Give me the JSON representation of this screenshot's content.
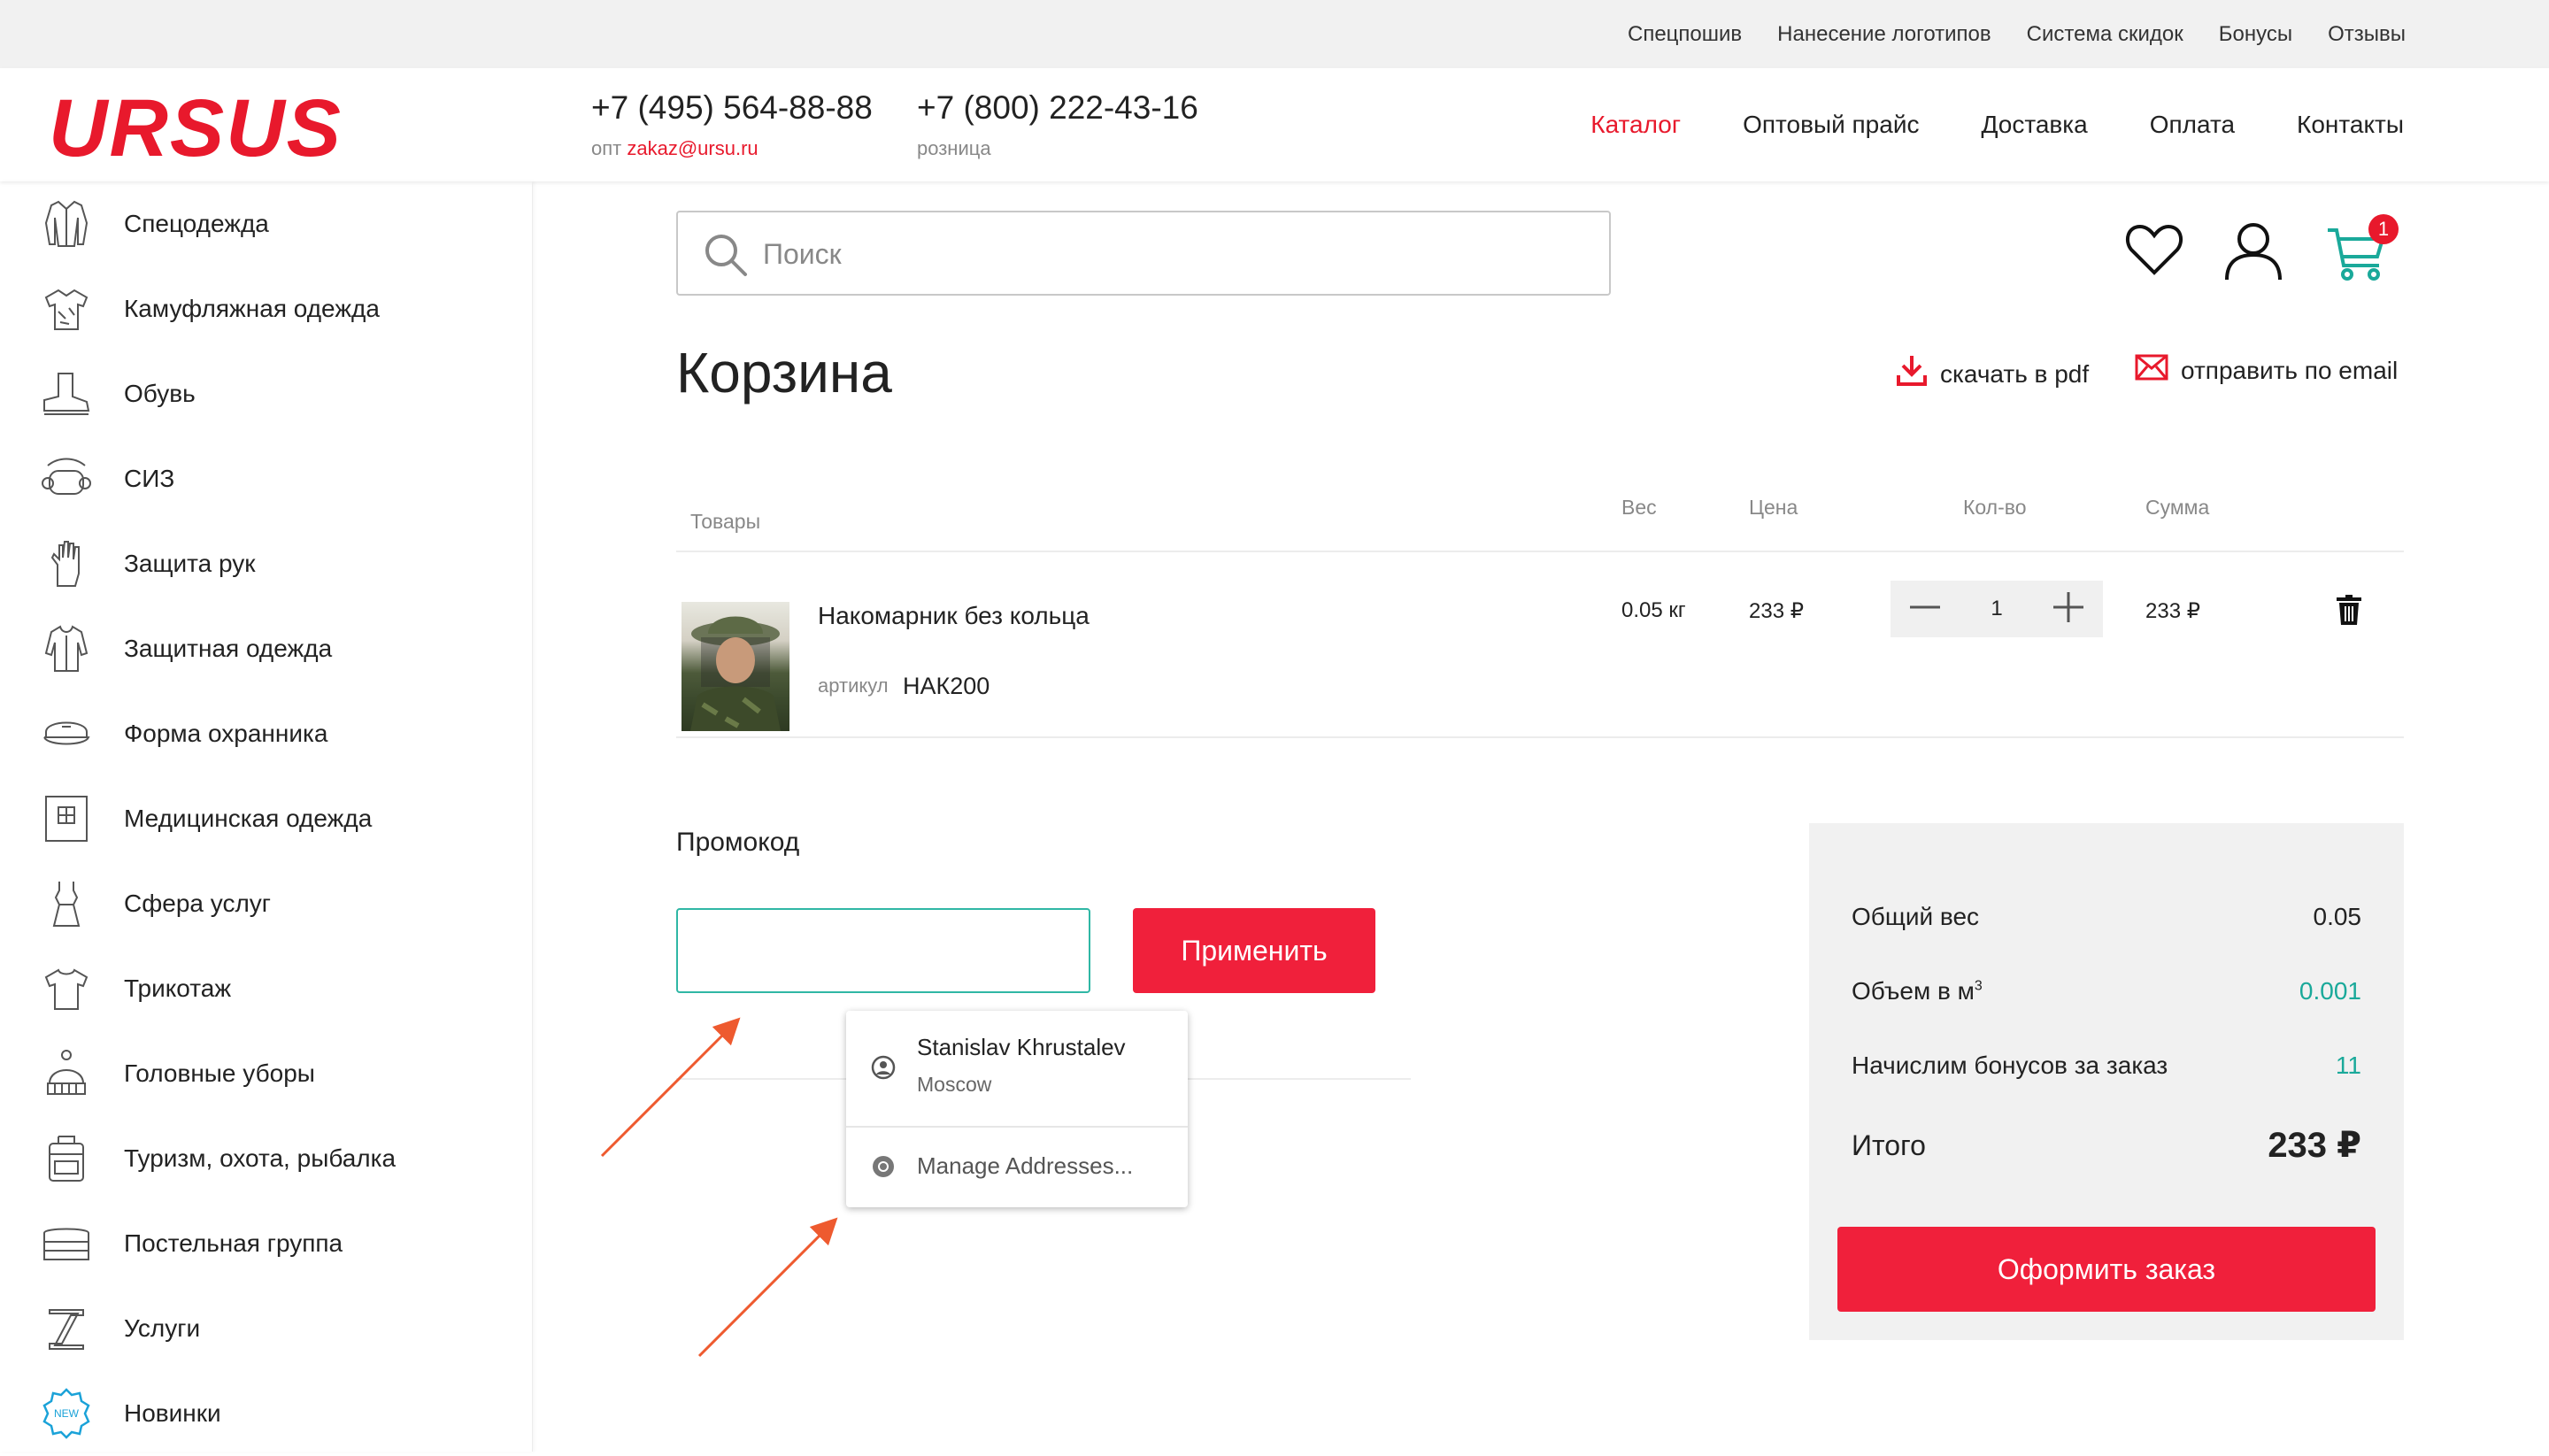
{
  "topbar": {
    "links": [
      "Спецпошив",
      "Нанесение логотипов",
      "Система скидок",
      "Бонусы",
      "Отзывы"
    ]
  },
  "header": {
    "logo": "URSUS",
    "phone_wholesale": "+7 (495) 564-88-88",
    "phone_wholesale_prefix": "опт",
    "phone_wholesale_email": "zakaz@ursu.ru",
    "phone_retail": "+7 (800) 222-43-16",
    "phone_retail_sub": "розница",
    "nav": [
      "Каталог",
      "Оптовый прайс",
      "Доставка",
      "Оплата",
      "Контакты"
    ],
    "nav_active": "Каталог"
  },
  "sidebar": {
    "items": [
      {
        "label": "Спецодежда",
        "icon": "jacket-icon"
      },
      {
        "label": "Камуфляжная одежда",
        "icon": "camo-shirt-icon"
      },
      {
        "label": "Обувь",
        "icon": "boot-icon"
      },
      {
        "label": "СИЗ",
        "icon": "respirator-icon"
      },
      {
        "label": "Защита рук",
        "icon": "glove-icon"
      },
      {
        "label": "Защитная одежда",
        "icon": "protective-suit-icon"
      },
      {
        "label": "Форма охранника",
        "icon": "guard-cap-icon"
      },
      {
        "label": "Медицинская одежда",
        "icon": "medical-icon"
      },
      {
        "label": "Сфера услуг",
        "icon": "dress-icon"
      },
      {
        "label": "Трикотаж",
        "icon": "tshirt-icon"
      },
      {
        "label": "Головные уборы",
        "icon": "hat-icon"
      },
      {
        "label": "Туризм, охота, рыбалка",
        "icon": "backpack-icon"
      },
      {
        "label": "Постельная группа",
        "icon": "bedding-icon"
      },
      {
        "label": "Услуги",
        "icon": "services-icon"
      },
      {
        "label": "Новинки",
        "icon": "new-badge-icon"
      }
    ]
  },
  "search": {
    "placeholder": "Поиск"
  },
  "cart_badge": "1",
  "page": {
    "title": "Корзина",
    "download_pdf": "скачать в pdf",
    "send_email": "отправить по email"
  },
  "table": {
    "headers": {
      "goods": "Товары",
      "weight": "Вес",
      "price": "Цена",
      "qty": "Кол-во",
      "sum": "Сумма"
    },
    "rows": [
      {
        "name": "Накомарник без кольца",
        "article_label": "артикул",
        "article": "НАК200",
        "weight": "0.05 кг",
        "price": "233 ₽",
        "qty": "1",
        "sum": "233 ₽"
      }
    ]
  },
  "promo": {
    "label": "Промокод",
    "value": "",
    "apply": "Применить"
  },
  "autofill": {
    "name": "Stanislav Khrustalev",
    "city": "Moscow",
    "manage": "Manage Addresses..."
  },
  "summary": {
    "total_weight_label": "Общий вес",
    "total_weight": "0.05",
    "volume_label": "Объем в м",
    "volume_sup": "3",
    "volume": "0.001",
    "bonus_label": "Начислим бонусов за заказ",
    "bonus": "11",
    "total_label": "Итого",
    "total": "233 ₽",
    "order_button": "Оформить заказ"
  },
  "colors": {
    "accent": "#e8192c",
    "button": "#f0203b",
    "teal": "#1aa99a",
    "arrow": "#ee5a2f"
  }
}
